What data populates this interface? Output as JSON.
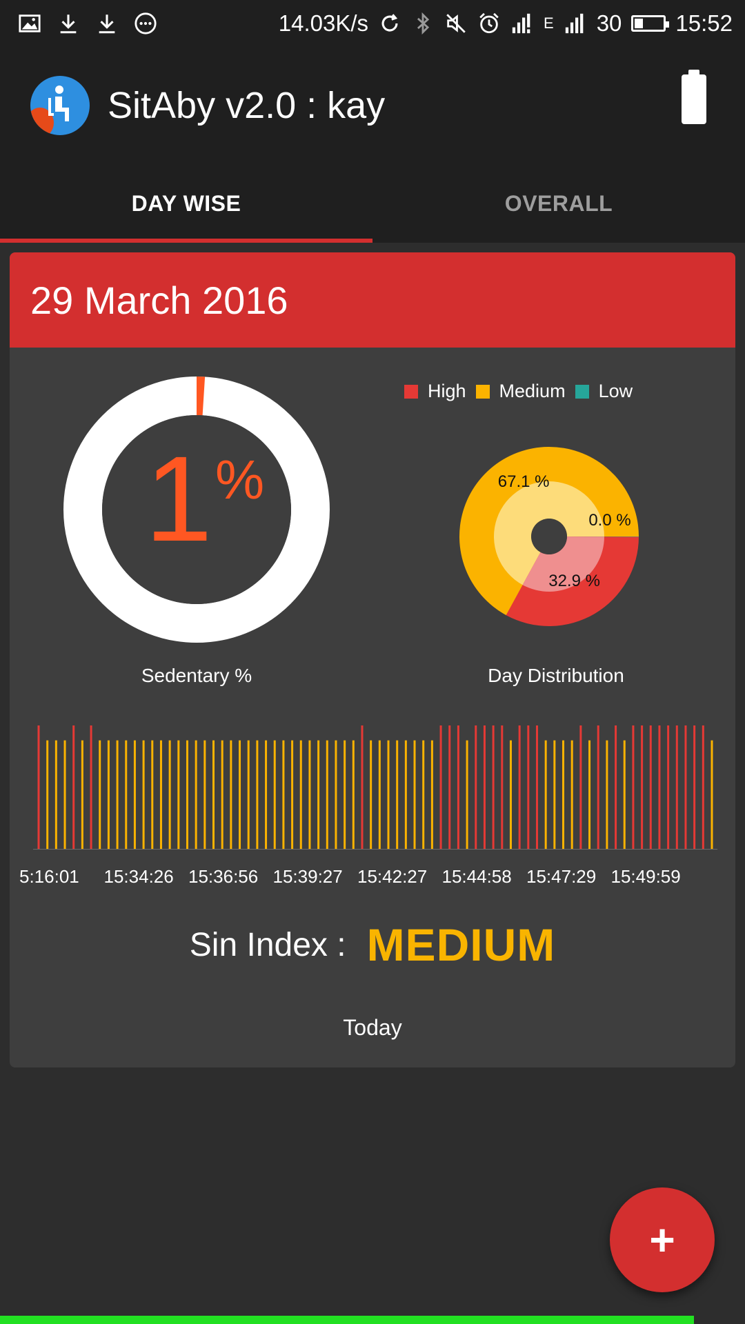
{
  "status_bar": {
    "net_speed": "14.03K/s",
    "network_type": "E",
    "battery_level": "30",
    "time": "15:52",
    "icons_left": [
      "image-icon",
      "download-icon",
      "download-icon",
      "more-icon"
    ],
    "icons_right": [
      "sync-icon",
      "bluetooth-icon",
      "mute-icon",
      "alarm-icon",
      "signal-icon",
      "signal-icon"
    ]
  },
  "toolbar": {
    "title": "SitAby v2.0 : kay",
    "logo_icon": "sitting-person-icon",
    "action_icon": "battery-icon"
  },
  "tabs": [
    {
      "label": "DAY WISE",
      "active": true
    },
    {
      "label": "OVERALL",
      "active": false
    }
  ],
  "card": {
    "date": "29 March 2016",
    "sedentary": {
      "value": "1",
      "unit": "%",
      "label": "Sedentary %",
      "fraction": 0.01
    },
    "distribution": {
      "label": "Day Distribution",
      "legend": [
        {
          "name": "High",
          "color": "#e53935"
        },
        {
          "name": "Medium",
          "color": "#fbb300"
        },
        {
          "name": "Low",
          "color": "#26a69a"
        }
      ]
    },
    "sin_index": {
      "label": "Sin Index :",
      "value": "MEDIUM"
    },
    "footer": "Today"
  },
  "fab": {
    "icon": "plus-icon",
    "label": "+"
  },
  "colors": {
    "accent": "#d32f2f",
    "high": "#e53935",
    "medium": "#fbb300",
    "low": "#26a69a",
    "sedentary": "#ff5722",
    "card_bg": "#3e3e3e"
  },
  "chart_data": [
    {
      "type": "pie",
      "categories": [
        "High",
        "Medium",
        "Low"
      ],
      "values": [
        32.9,
        67.1,
        0.0
      ],
      "data_labels": [
        "32.9 %",
        "67.1 %",
        "0.0 %"
      ],
      "title": "Day Distribution"
    },
    {
      "type": "bar",
      "x_tick_labels": [
        "5:16:01",
        "15:34:26",
        "15:36:56",
        "15:39:27",
        "15:42:27",
        "15:44:58",
        "15:47:29",
        "15:49:59"
      ],
      "series": [
        {
          "name": "High",
          "level": 1.0
        },
        {
          "name": "Medium",
          "level": 0.88
        }
      ],
      "bars": [
        "High",
        "Medium",
        "Medium",
        "Medium",
        "High",
        "Medium",
        "High",
        "Medium",
        "Medium",
        "Medium",
        "Medium",
        "Medium",
        "Medium",
        "Medium",
        "Medium",
        "Medium",
        "Medium",
        "Medium",
        "Medium",
        "Medium",
        "Medium",
        "Medium",
        "Medium",
        "Medium",
        "Medium",
        "Medium",
        "Medium",
        "Medium",
        "Medium",
        "Medium",
        "Medium",
        "Medium",
        "Medium",
        "Medium",
        "Medium",
        "Medium",
        "Medium",
        "High",
        "Medium",
        "Medium",
        "Medium",
        "Medium",
        "Medium",
        "Medium",
        "Medium",
        "Medium",
        "High",
        "High",
        "High",
        "Medium",
        "High",
        "High",
        "High",
        "High",
        "Medium",
        "High",
        "High",
        "High",
        "Medium",
        "Medium",
        "Medium",
        "Medium",
        "High",
        "Medium",
        "High",
        "Medium",
        "High",
        "Medium",
        "High",
        "High",
        "High",
        "High",
        "High",
        "High",
        "High",
        "High",
        "High",
        "Medium"
      ]
    }
  ]
}
